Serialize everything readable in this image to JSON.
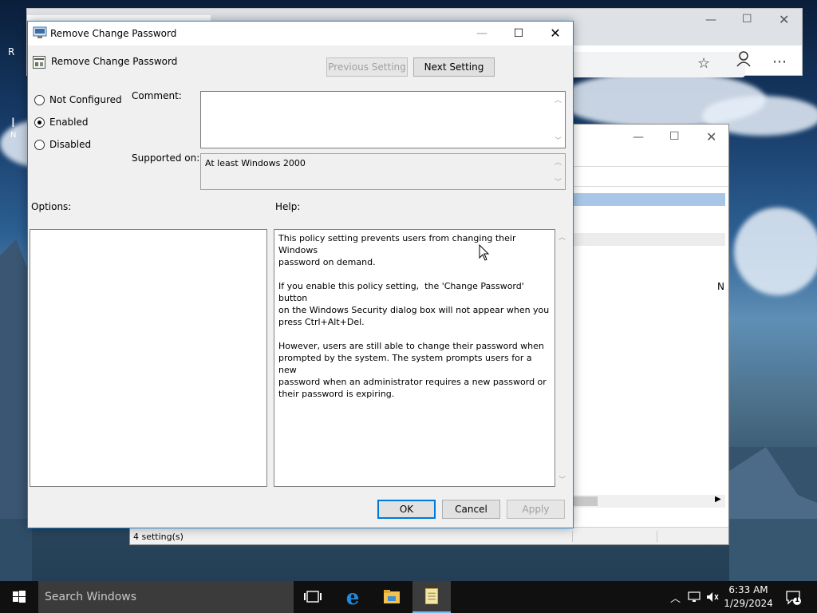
{
  "desktop": {
    "fragment_left_1": "R",
    "fragment_left_2": "I",
    "fragment_left_3": "N"
  },
  "dialog": {
    "title": "Remove Change Password",
    "setting_name": "Remove Change Password",
    "prev_button": "Previous Setting",
    "next_button": "Next Setting",
    "radio": {
      "not_configured": "Not Configured",
      "enabled": "Enabled",
      "disabled": "Disabled",
      "selected": "Enabled"
    },
    "comment_label": "Comment:",
    "comment_value": "",
    "supported_label": "Supported on:",
    "supported_value": "At least Windows 2000",
    "options_label": "Options:",
    "help_label": "Help:",
    "help_text": "This policy setting prevents users from changing their Windows\npassword on demand.\n\nIf you enable this policy setting,  the 'Change Password' button\non the Windows Security dialog box will not appear when you\npress Ctrl+Alt+Del.\n\nHowever, users are still able to change their password when\nprompted by the system. The system prompts users for a new\npassword when an administrator requires a new password or\ntheir password is expiring.",
    "ok_button": "OK",
    "cancel_button": "Cancel",
    "apply_button": "Apply"
  },
  "mmc": {
    "status_text": "4 setting(s)",
    "fragment_n": "N"
  },
  "taskbar": {
    "search_placeholder": "Search Windows",
    "time": "6:33 AM",
    "date": "1/29/2024",
    "notification_count": "1"
  },
  "colors": {
    "accent": "#0078d7",
    "dialog_border": "#1883d7",
    "taskbar": "#101010",
    "search_box": "#3b3b3b"
  },
  "icons": {
    "window_controls": [
      "minimize-icon",
      "maximize-icon",
      "close-icon"
    ],
    "browser": [
      "star-icon",
      "profile-icon",
      "more-icon"
    ],
    "taskbar": [
      "windows-start-icon",
      "task-view-icon",
      "edge-icon",
      "file-explorer-icon",
      "notepad-icon"
    ],
    "tray": [
      "chevron-up-icon",
      "network-icon",
      "volume-muted-icon",
      "action-center-icon"
    ]
  }
}
